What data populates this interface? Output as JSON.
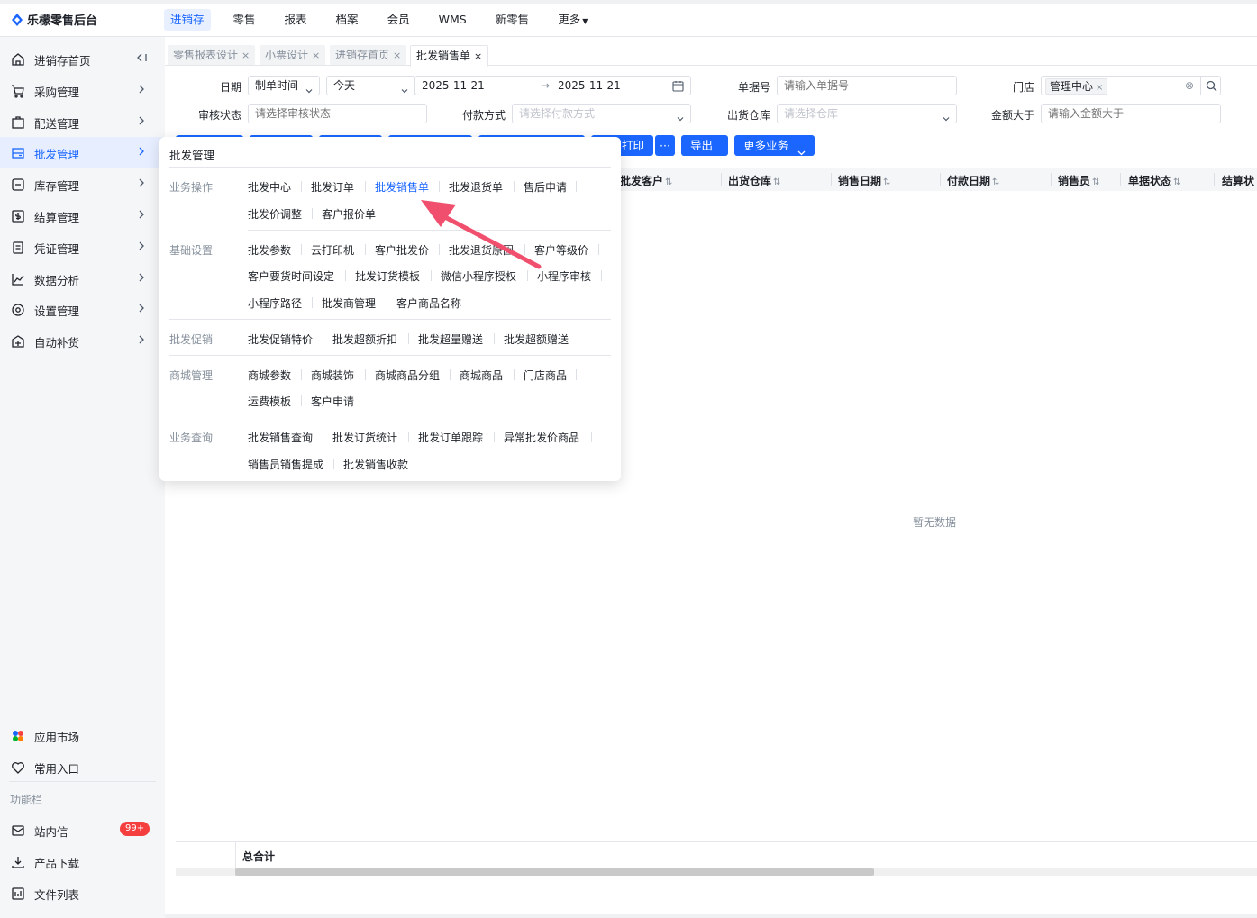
{
  "app": {
    "title": "乐檬零售后台"
  },
  "topnav": [
    "进销存",
    "零售",
    "报表",
    "档案",
    "会员",
    "WMS",
    "新零售",
    "更多"
  ],
  "sidebar": {
    "items": [
      "进销存首页",
      "采购管理",
      "配送管理",
      "批发管理",
      "库存管理",
      "结算管理",
      "凭证管理",
      "数据分析",
      "设置管理",
      "自动补货"
    ],
    "bottom": [
      "应用市场",
      "常用入口"
    ],
    "section": "功能栏",
    "tools": [
      "站内信",
      "产品下载",
      "文件列表"
    ],
    "badge": "99+"
  },
  "tabs": [
    "零售报表设计",
    "小票设计",
    "进销存首页",
    "批发销售单"
  ],
  "filters": {
    "date_label": "日期",
    "date_type": "制单时间",
    "date_range": "今天",
    "date_start": "2025-11-21",
    "date_end": "2025-11-21",
    "order_no_label": "单据号",
    "order_no_placeholder": "请输入单据号",
    "store_label": "门店",
    "store_value": "管理中心",
    "audit_label": "审核状态",
    "audit_placeholder": "请选择审核状态",
    "pay_label": "付款方式",
    "pay_placeholder": "请选择付款方式",
    "warehouse_label": "出货仓库",
    "warehouse_placeholder": "请选择仓库",
    "amount_label": "金额大于",
    "amount_placeholder": "请输入金额大于"
  },
  "toolbar": {
    "print": "打印",
    "more_dots": "···",
    "export": "导出",
    "more_business": "更多业务"
  },
  "table": {
    "headers": [
      "批发客户",
      "出货仓库",
      "销售日期",
      "付款日期",
      "销售员",
      "单据状态",
      "结算状"
    ],
    "empty": "暂无数据",
    "total": "总合计"
  },
  "menu": {
    "title": "批发管理",
    "sections": [
      {
        "name": "业务操作",
        "rows": [
          [
            "批发中心",
            "批发订单",
            "批发销售单",
            "批发退货单",
            "售后申请"
          ],
          [
            "批发价调整",
            "客户报价单"
          ]
        ]
      },
      {
        "name": "基础设置",
        "rows": [
          [
            "批发参数",
            "云打印机",
            "客户批发价",
            "批发退货原因",
            "客户等级价"
          ],
          [
            "客户要货时间设定",
            "批发订货模板",
            "微信小程序授权",
            "小程序审核"
          ],
          [
            "小程序路径",
            "批发商管理",
            "客户商品名称"
          ]
        ]
      },
      {
        "name": "批发促销",
        "rows": [
          [
            "批发促销特价",
            "批发超额折扣",
            "批发超量赠送",
            "批发超额赠送"
          ]
        ]
      },
      {
        "name": "商城管理",
        "rows": [
          [
            "商城参数",
            "商城装饰",
            "商城商品分组",
            "商城商品",
            "门店商品"
          ],
          [
            "运费模板",
            "客户申请"
          ]
        ]
      },
      {
        "name": "业务查询",
        "rows": [
          [
            "批发销售查询",
            "批发订货统计",
            "批发订单跟踪",
            "异常批发价商品"
          ],
          [
            "销售员销售提成",
            "批发销售收款"
          ]
        ]
      }
    ]
  },
  "colors": {
    "primary": "#1a66ff",
    "arrow": "#f0506e",
    "badge": "#f53f3f"
  }
}
